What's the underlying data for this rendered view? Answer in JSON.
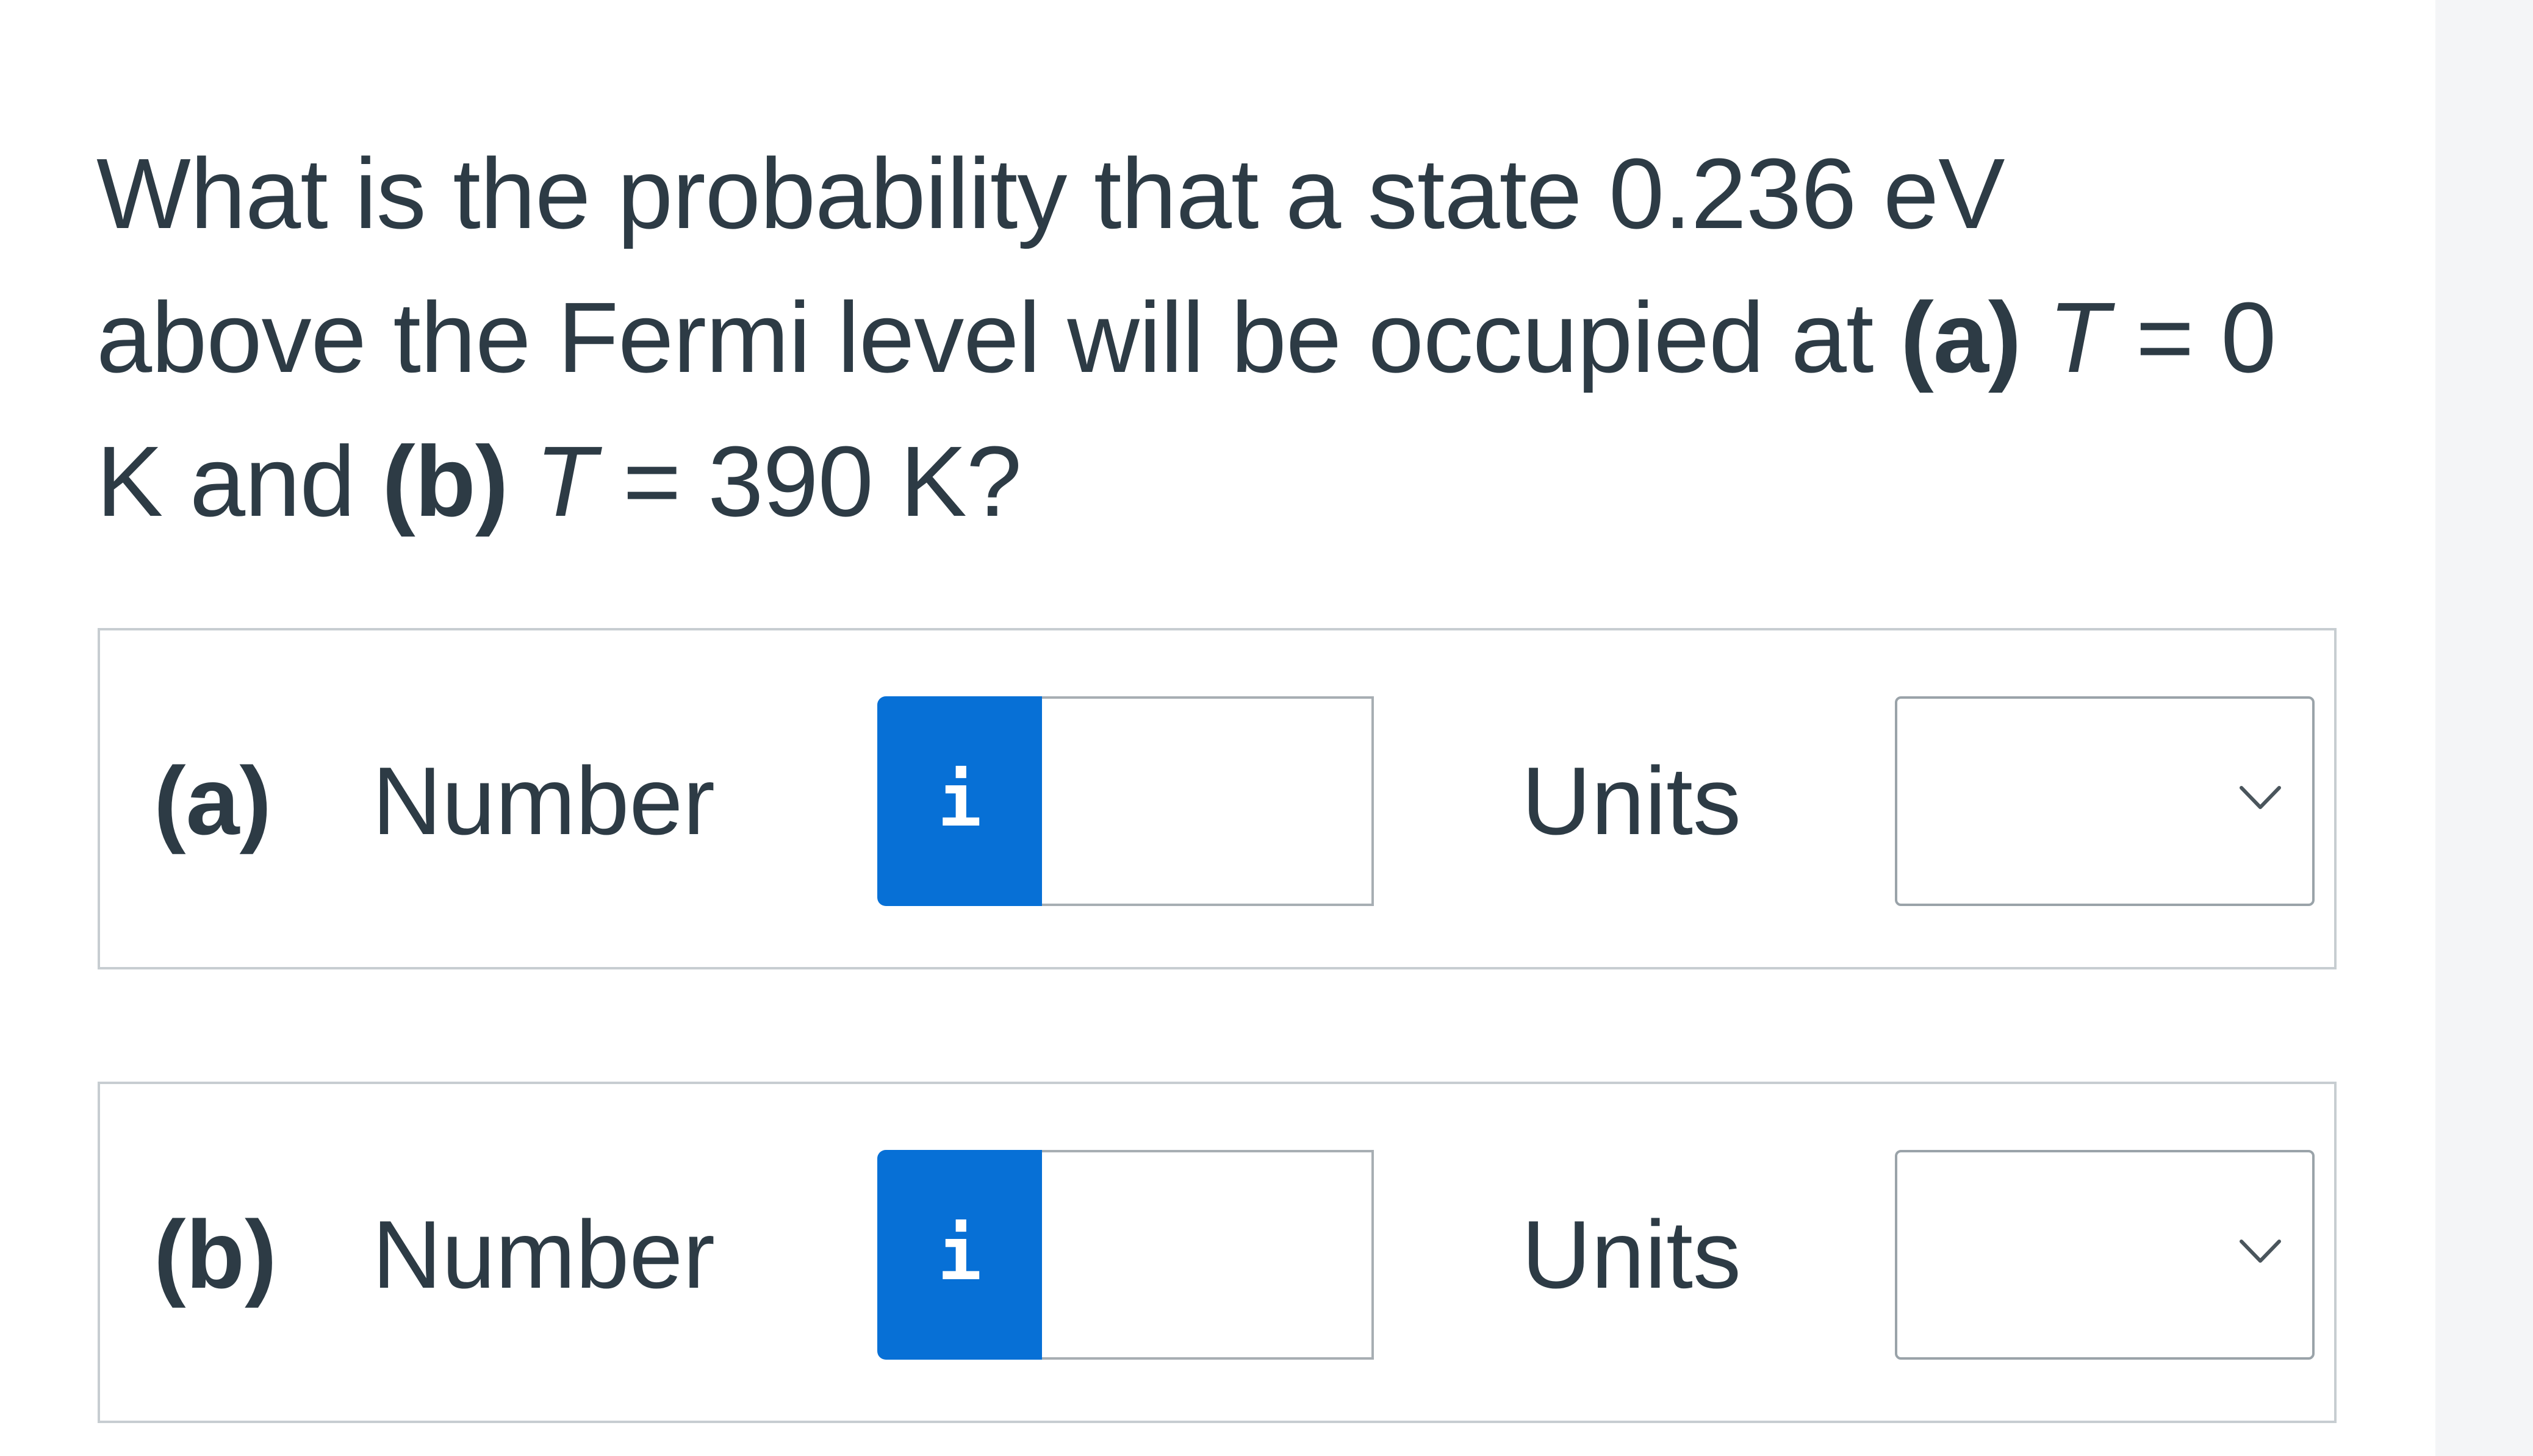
{
  "question": {
    "line1": "What is the probability that a state 0.236 eV",
    "line2_pre": "above the Fermi level will be occupied at ",
    "line2_a": "(a)",
    "line2_T": "T",
    "line2_post": " = 0",
    "line3_pre": "K and ",
    "line3_b": "(b)",
    "line3_T": "T",
    "line3_post": " = 390 K?"
  },
  "parts": [
    {
      "label": "(a)",
      "number_label": "Number",
      "info_icon": "i",
      "number_value": "",
      "units_label": "Units",
      "units_selected": ""
    },
    {
      "label": "(b)",
      "number_label": "Number",
      "info_icon": "i",
      "number_value": "",
      "units_label": "Units",
      "units_selected": ""
    }
  ],
  "colors": {
    "info_button": "#0770d6",
    "text": "#2d3b45",
    "box_border": "#c7cdd1"
  }
}
